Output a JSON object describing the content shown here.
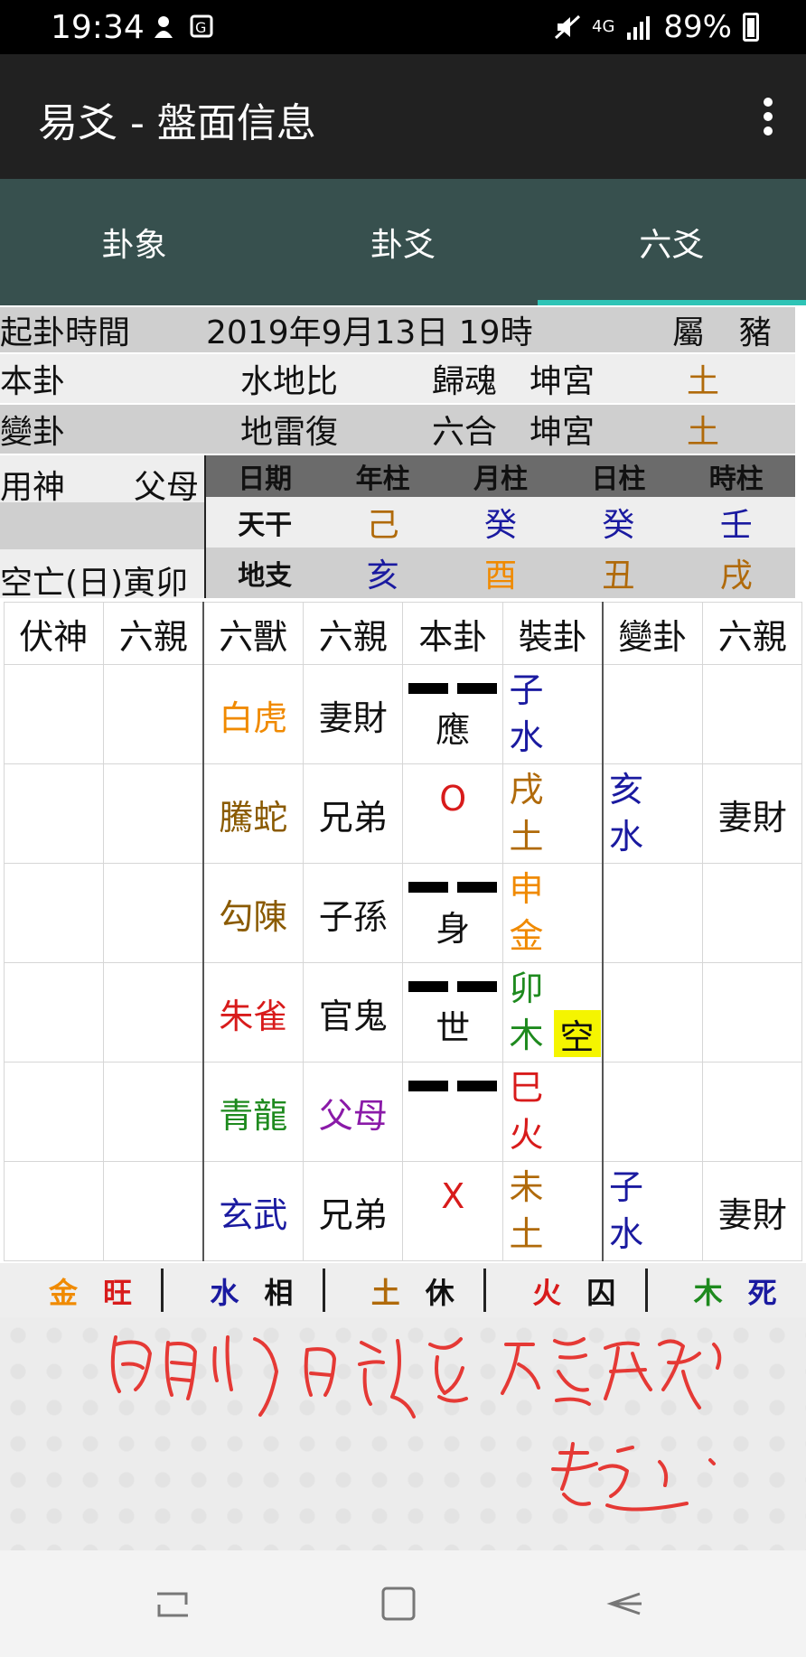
{
  "status_bar": {
    "time": "19:34",
    "network": "4G",
    "battery": "89%"
  },
  "app_bar": {
    "title": "易爻 - 盤面信息"
  },
  "tabs": [
    {
      "label": "卦象",
      "active": false
    },
    {
      "label": "卦爻",
      "active": false
    },
    {
      "label": "六爻",
      "active": true
    }
  ],
  "info": {
    "time_label": "起卦時間",
    "time_value": "2019年9月13日 19時",
    "zodiac_label": "屬",
    "zodiac_value": "豬",
    "main_label": "本卦",
    "main_name": "水地比",
    "main_type": "歸魂",
    "main_palace": "坤宮",
    "main_element": "土",
    "changed_label": "變卦",
    "changed_name": "地雷復",
    "changed_type": "六合",
    "changed_palace": "坤宮",
    "changed_element": "土",
    "useful_label": "用神",
    "useful_value": "父母",
    "void_label": "空亡(日)寅卯"
  },
  "pillars": {
    "headers": [
      "日期",
      "年柱",
      "月柱",
      "日柱",
      "時柱"
    ],
    "stem_label": "天干",
    "stems": [
      {
        "text": "己",
        "color": "#b06a0a"
      },
      {
        "text": "癸",
        "color": "#1a1aa0"
      },
      {
        "text": "癸",
        "color": "#1a1aa0"
      },
      {
        "text": "壬",
        "color": "#1a1aa0"
      }
    ],
    "branch_label": "地支",
    "branches": [
      {
        "text": "亥",
        "color": "#1a1aa0"
      },
      {
        "text": "酉",
        "color": "#f08a00"
      },
      {
        "text": "丑",
        "color": "#b06a0a"
      },
      {
        "text": "戌",
        "color": "#b06a0a"
      }
    ]
  },
  "grid": {
    "headers": [
      "伏神",
      "六親",
      "六獸",
      "六親",
      "本卦",
      "裝卦",
      "變卦",
      "六親"
    ],
    "rows": [
      {
        "beast": "白虎",
        "beast_color": "#f08a00",
        "relative": "妻財",
        "relative_color": "#111111",
        "line": "yin",
        "mark": "應",
        "mark_color": "#111111",
        "branch": [
          "子",
          "水"
        ],
        "branch_color": "#1a1aa0",
        "void": "",
        "changed": [],
        "changed_color": "#1a1aa0",
        "changed_relative": ""
      },
      {
        "beast": "騰蛇",
        "beast_color": "#8a5a00",
        "relative": "兄弟",
        "relative_color": "#111111",
        "line": "moving-yang",
        "mark": "O",
        "mark_color": "#d81b1b",
        "branch": [
          "戌",
          "土"
        ],
        "branch_color": "#b06a0a",
        "void": "",
        "changed": [
          "亥",
          "水"
        ],
        "changed_color": "#1a1aa0",
        "changed_relative": "妻財"
      },
      {
        "beast": "勾陳",
        "beast_color": "#8a5a00",
        "relative": "子孫",
        "relative_color": "#111111",
        "line": "yin",
        "mark": "身",
        "mark_color": "#111111",
        "branch": [
          "申",
          "金"
        ],
        "branch_color": "#f08a00",
        "void": "",
        "changed": [],
        "changed_color": "#1a1aa0",
        "changed_relative": ""
      },
      {
        "beast": "朱雀",
        "beast_color": "#d81b1b",
        "relative": "官鬼",
        "relative_color": "#111111",
        "line": "yin",
        "mark": "世",
        "mark_color": "#111111",
        "branch": [
          "卯",
          "木"
        ],
        "branch_color": "#1e8a1e",
        "void": "空",
        "changed": [],
        "changed_color": "#1a1aa0",
        "changed_relative": ""
      },
      {
        "beast": "青龍",
        "beast_color": "#1e8a1e",
        "relative": "父母",
        "relative_color": "#8a1aa8",
        "line": "yin",
        "mark": "",
        "mark_color": "#111111",
        "branch": [
          "巳",
          "火"
        ],
        "branch_color": "#d81b1b",
        "void": "",
        "changed": [],
        "changed_color": "#1a1aa0",
        "changed_relative": ""
      },
      {
        "beast": "玄武",
        "beast_color": "#1a1aa0",
        "relative": "兄弟",
        "relative_color": "#111111",
        "line": "moving-yin",
        "mark": "X",
        "mark_color": "#d81b1b",
        "branch": [
          "未",
          "土"
        ],
        "branch_color": "#b06a0a",
        "void": "",
        "changed": [
          "子",
          "水"
        ],
        "changed_color": "#1a1aa0",
        "changed_relative": "妻財"
      }
    ]
  },
  "wuxing": [
    {
      "element": "金",
      "element_color": "#f08a00",
      "state": "旺",
      "state_color": "#d81b1b"
    },
    {
      "element": "水",
      "element_color": "#1a1aa0",
      "state": "相",
      "state_color": "#111111"
    },
    {
      "element": "土",
      "element_color": "#b06a0a",
      "state": "休",
      "state_color": "#111111"
    },
    {
      "element": "火",
      "element_color": "#d81b1b",
      "state": "囚",
      "state_color": "#111111"
    },
    {
      "element": "木",
      "element_color": "#1e8a1e",
      "state": "死",
      "state_color": "#1a1aa0"
    }
  ],
  "colors": {
    "accent": "#2ec4b6",
    "tab_bg": "#37504e",
    "app_bar_bg": "#212121",
    "ink": "#e53935"
  }
}
